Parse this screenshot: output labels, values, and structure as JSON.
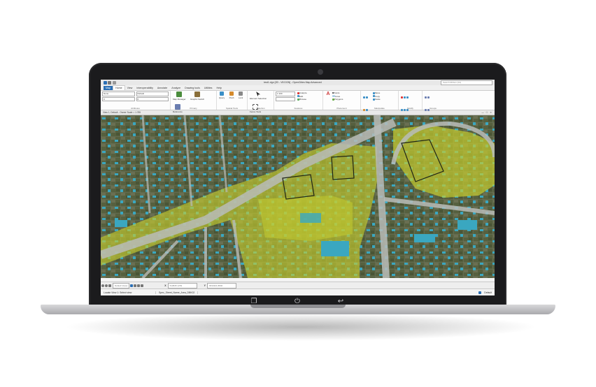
{
  "app": {
    "window_title": "test1.dgn [2D - V8 DGN] - OpenCities Map Advanced",
    "search_placeholder": "Search Ribbon (F4)"
  },
  "tabs": [
    "Map",
    "Home",
    "View",
    "Interoperability",
    "Annotate",
    "Analyze",
    "Drawing tools",
    "Utilities",
    "Help"
  ],
  "ribbon": {
    "groups": [
      {
        "label": "Attributes",
        "items": [
          "None",
          "Default",
          "0",
          "0",
          "0"
        ]
      },
      {
        "label": "Primary",
        "items": [
          "Map Manager",
          "Graphic Switch",
          "Reference",
          "Models",
          "Level Display"
        ]
      },
      {
        "label": "Spatial Tools",
        "items": [
          "Query",
          "Push",
          "Lock"
        ]
      },
      {
        "label": "Selection",
        "items": [
          "Element Selection",
          "Fence Tools"
        ]
      },
      {
        "label": "Features",
        "items": [
          "1:100",
          "Analyze",
          "Edit",
          "Browse"
        ]
      },
      {
        "label": "Placement",
        "items": [
          "Points",
          "Lines",
          "Polygons"
        ]
      },
      {
        "label": "Manipulate",
        "items": [
          "Move",
          "Copy",
          "Scale"
        ]
      },
      {
        "label": "Modify",
        "items": []
      },
      {
        "label": "Groups",
        "items": []
      }
    ]
  },
  "view": {
    "title": "View 1, Default - Owner Scale = 1:785",
    "controls": "— ☐ ✕"
  },
  "bottombar": {
    "view_selector": "Default Views",
    "x_label": "X",
    "x_value": "510845.1253",
    "y_label": "Y",
    "y_value": "6634321.8846"
  },
  "statusbar": {
    "left": "Locate View 1: Select view",
    "file": "Spec_Street_Name_Area_DBK02",
    "right": "Default"
  },
  "colors": {
    "highlight": "#c8cf2d",
    "building": "#3aa7c0",
    "road": "#b9bcb8",
    "terrain": "#4c5a3a",
    "ribbon_accent": "#2b6fb5"
  },
  "device": {
    "bezel_buttons": [
      "recent-apps",
      "power",
      "back"
    ]
  }
}
